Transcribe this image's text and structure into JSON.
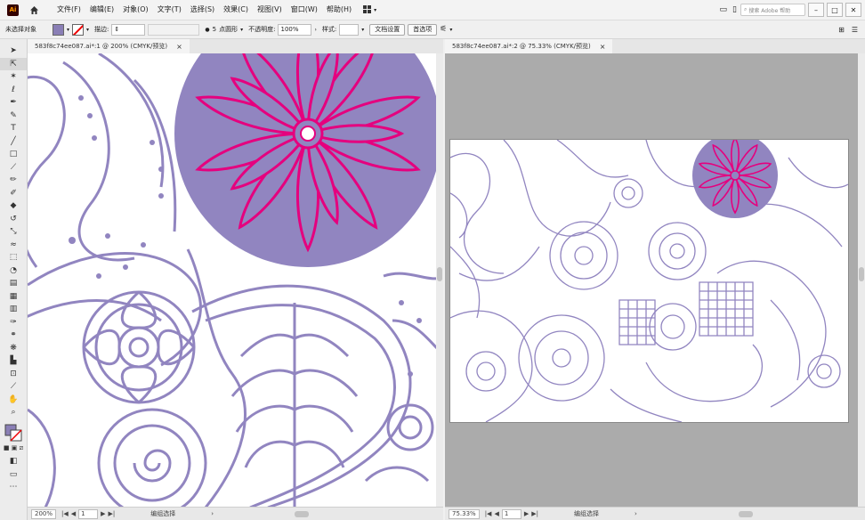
{
  "app": {
    "logo_text": "Ai"
  },
  "menu": {
    "items": [
      "文件(F)",
      "编辑(E)",
      "对象(O)",
      "文字(T)",
      "选择(S)",
      "效果(C)",
      "视图(V)",
      "窗口(W)",
      "帮助(H)"
    ]
  },
  "search": {
    "placeholder": "搜索 Adobe 帮助"
  },
  "control": {
    "selection_label": "未选择对象",
    "stroke_label": "描边:",
    "point_value": "5",
    "brush_label": "点圆形",
    "opacity_label": "不透明度:",
    "opacity_value": "100%",
    "style_label": "样式:",
    "doc_setup": "文档设置",
    "preferences": "首选项"
  },
  "colors": {
    "fill": "#8a7fb6",
    "accent_pink": "#e5007e",
    "artwork_purple": "#9185c0",
    "background_gray": "#ababab"
  },
  "left_doc": {
    "tab_title": "583f8c74ee087.ai* @ 200% (CMYK/预览)",
    "tab_close": "×",
    "zoom": "200%",
    "page": "1",
    "status_tool": "编组选择"
  },
  "right_doc": {
    "tab_title": "583f8c74ee087.ai*:2 @ 75.33% (CMYK/预览)",
    "tab_close": "×",
    "zoom": "75.33%",
    "page": "1",
    "status_tool": "编组选择"
  },
  "inactive_tab": {
    "title": "583f8c74ee087.ai*:1 @ 200% (CMYK/预览)"
  },
  "tools": [
    "selection-tool",
    "direct-selection-tool",
    "magic-wand-tool",
    "lasso-tool",
    "pen-tool",
    "curvature-tool",
    "type-tool",
    "line-tool",
    "rectangle-tool",
    "paintbrush-tool",
    "pencil-tool",
    "shaper-tool",
    "eraser-tool",
    "rotate-tool",
    "scale-tool",
    "width-tool",
    "free-transform-tool",
    "shape-builder-tool",
    "perspective-grid-tool",
    "mesh-tool",
    "gradient-tool",
    "eyedropper-tool",
    "blend-tool",
    "symbol-sprayer-tool",
    "column-graph-tool",
    "artboard-tool",
    "slice-tool",
    "hand-tool",
    "zoom-tool"
  ]
}
